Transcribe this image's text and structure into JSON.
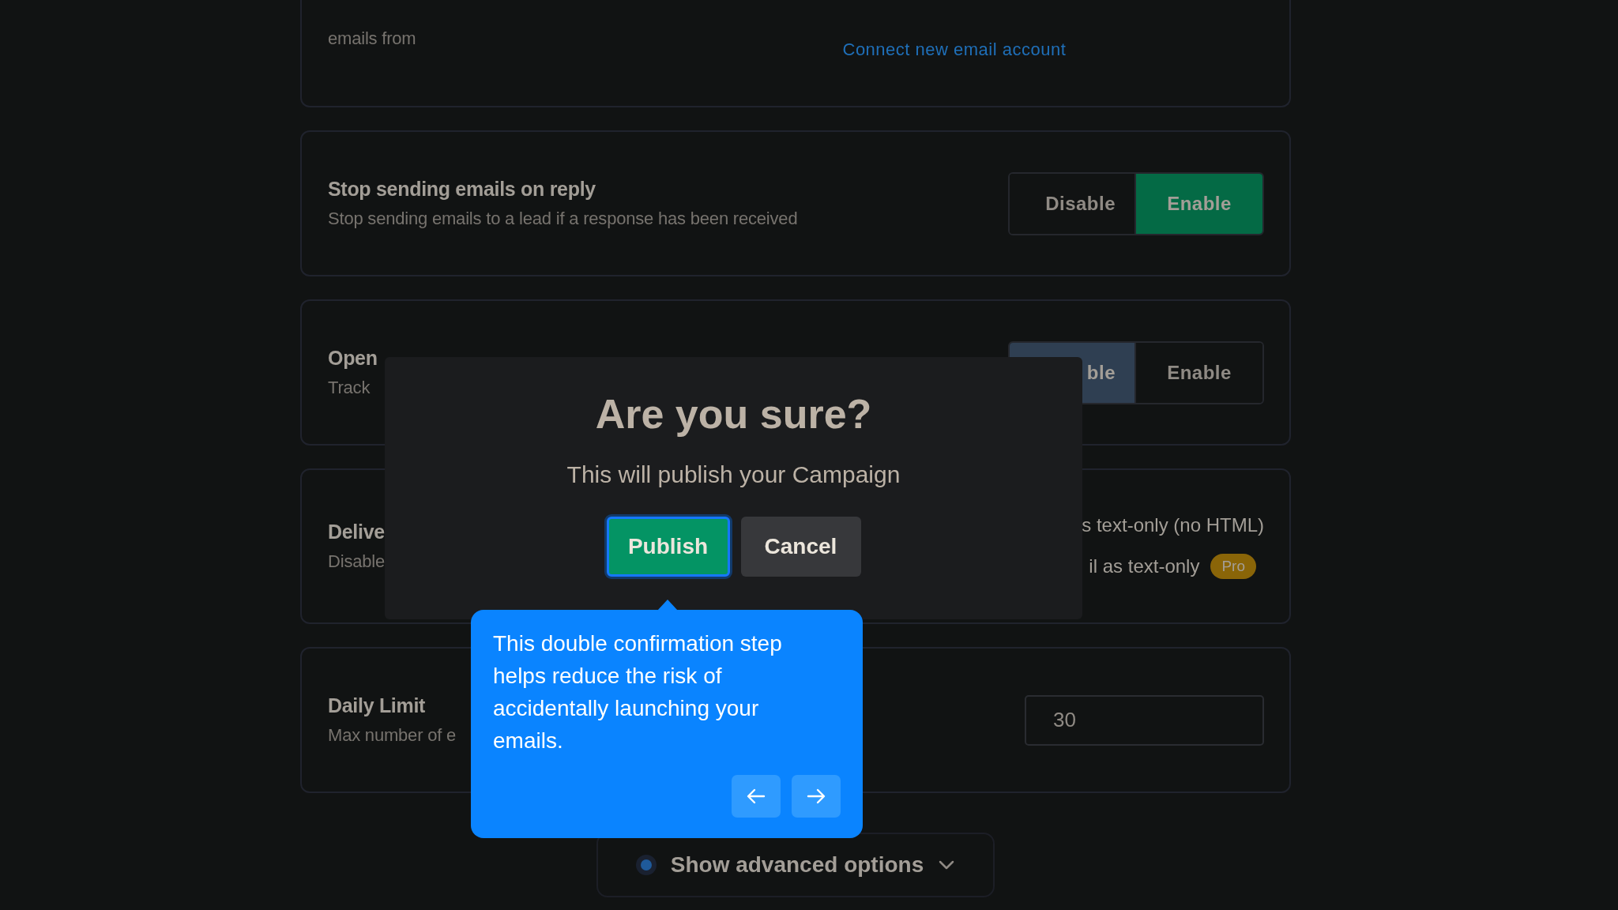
{
  "top_card": {
    "text": "emails from",
    "link": "Connect new email account"
  },
  "settings": [
    {
      "kind": "toggle",
      "title": "Stop sending emails on reply",
      "subtitle": "Stop sending emails to a lead if a response has been received",
      "options": [
        {
          "label": "Disable",
          "selected": false
        },
        {
          "label": "Enable",
          "selected": true
        }
      ]
    },
    {
      "kind": "toggle",
      "title": "Open",
      "subtitle": "Track",
      "options": [
        {
          "label": "ble",
          "selected": true
        },
        {
          "label": "Enable",
          "selected": false
        }
      ]
    },
    {
      "kind": "options",
      "title": "Delive",
      "subtitle": "Disable",
      "options": [
        {
          "label": "s text-only (no HTML)"
        },
        {
          "label": "il as text-only",
          "badge": "Pro"
        }
      ]
    },
    {
      "kind": "number",
      "title": "Daily Limit",
      "subtitle": "Max number of e",
      "value": "30"
    }
  ],
  "advanced_button": {
    "label": "Show advanced options"
  },
  "dialog": {
    "title": "Are you sure?",
    "message": "This will publish your Campaign",
    "buttons": [
      {
        "kind": "primary",
        "label": "Publish"
      },
      {
        "kind": "secondary",
        "label": "Cancel"
      }
    ]
  },
  "tooltip": {
    "text": "This double confirmation step helps reduce the risk of accidentally launching your emails."
  }
}
